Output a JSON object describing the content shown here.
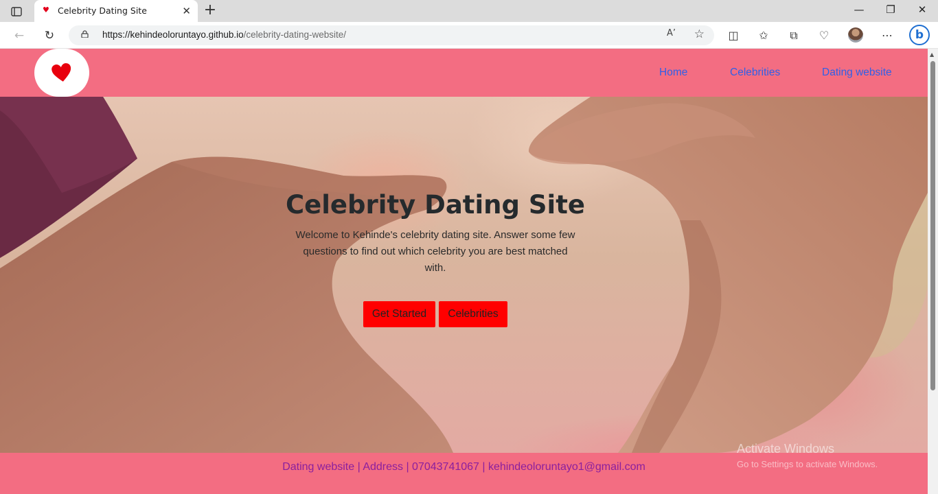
{
  "browser": {
    "tab_title": "Celebrity Dating Site",
    "url_host": "https://kehindeoloruntayo.github.io",
    "url_path": "/celebrity-dating-website/",
    "read_aloud_label": "A’"
  },
  "site": {
    "nav": {
      "home": "Home",
      "celebrities": "Celebrities",
      "dating_website": "Dating website"
    },
    "hero": {
      "title": "Celebrity Dating Site",
      "text": "Welcome to Kehinde's celebrity dating site. Answer some few questions to find out which celebrity you are best matched with.",
      "get_started": "Get Started",
      "celebrities_button": "Celebrities"
    },
    "footer": {
      "text": "Dating website | Address | 07043741067 | kehindeoloruntayo1@gmail.com"
    }
  },
  "os_watermark": {
    "line1": "Activate Windows",
    "line2": "Go to Settings to activate Windows."
  },
  "colors": {
    "header_bg": "#f36d82",
    "nav_link": "#2f60e8",
    "button_bg": "#ff0000",
    "footer_text": "#8b1f9e"
  },
  "icons": [
    "tab-actions-icon",
    "heart-favicon-icon",
    "close-icon",
    "new-tab-icon",
    "minimize-icon",
    "restore-icon",
    "window-close-icon",
    "back-icon",
    "refresh-icon",
    "lock-icon",
    "read-aloud-icon",
    "favorite-star-icon",
    "split-screen-icon",
    "favorites-icon",
    "collections-icon",
    "performance-icon",
    "profile-avatar",
    "more-icon",
    "bing-icon",
    "heart-logo-icon"
  ]
}
